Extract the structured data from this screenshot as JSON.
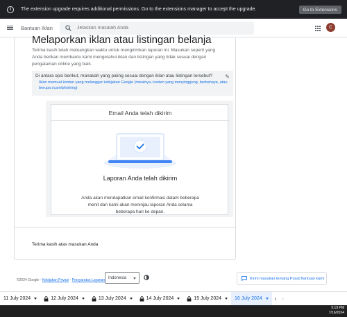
{
  "banner": {
    "message": "The extension upgrade requires additional permissions. Go to the extensions manager to accept the upgrade.",
    "button_label": "Go to Extensions"
  },
  "header": {
    "app_title": "Bantuan Iklan",
    "search_placeholder": "Jelaskan masalah Anda",
    "avatar_letter": "C"
  },
  "main": {
    "page_title": "Melaporkan iklan atau listingan belanja",
    "intro": "Terima kasih telah meluangkan waktu untuk mengirimkan laporan ini. Masukan seperti yang Anda berikan membantu kami mengetahui iklan dan listingan yang tidak sesuai dengan pengalaman online yang baik.",
    "question": "Di antara opsi berikut, manakah yang paling sesuai dengan iklan atau listingan tersebut?",
    "answer": "Iklan memuat konten yang melanggar kebijakan Google (misalnya, konten yang menyinggung, berbahaya, atau berupa scam/phishing)",
    "email_sent": "Email Anda telah dikirim",
    "report_sent": "Laporan Anda telah dikirim",
    "report_desc": "Anda akan mendapatkan email konfirmasi dalam beberapa menit dan kami akan meninjau laporan Anda selama beberapa hari ke depan.",
    "thanks": "Terima kasih atas masukan Anda"
  },
  "footer": {
    "copyright": "©2024 Google -",
    "privacy": "Kebijakan Privasi",
    "sep": "-",
    "terms": "Persyaratan Layanan",
    "language": "Indonesia",
    "feedback": "Kirim masukan tentang Pusat Bantuan kami"
  },
  "datebar": {
    "tabs": [
      {
        "label": "11 July 2024",
        "locked": false,
        "active": false
      },
      {
        "label": "12 July 2024",
        "locked": true,
        "active": false
      },
      {
        "label": "13 July 2024",
        "locked": true,
        "active": false
      },
      {
        "label": "14 July 2024",
        "locked": true,
        "active": false
      },
      {
        "label": "15 July 2024",
        "locked": true,
        "active": false
      },
      {
        "label": "16 July 2024",
        "locked": false,
        "active": true
      }
    ]
  },
  "taskbar": {
    "time": "5:19 PM",
    "date": "7/16/2024"
  },
  "colors": {
    "accent": "#1a73e8",
    "banner_bg": "#202124",
    "avatar": "#8d3a2f"
  }
}
